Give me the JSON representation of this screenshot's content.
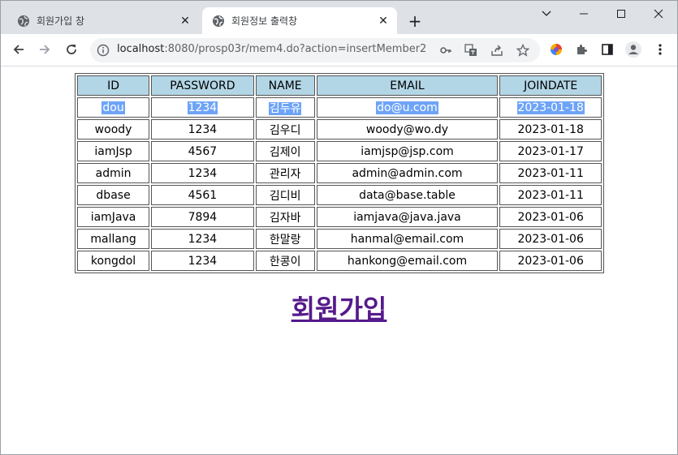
{
  "browser": {
    "tabs": [
      {
        "title": "회원가입 창",
        "active": false
      },
      {
        "title": "회원정보 출력창",
        "active": true
      }
    ],
    "url_host": "localhost",
    "url_path": ":8080/prosp03r/mem4.do?action=insertMember2"
  },
  "table": {
    "headers": [
      "ID",
      "PASSWORD",
      "NAME",
      "EMAIL",
      "JOINDATE"
    ],
    "rows": [
      [
        "dou",
        "1234",
        "김두유",
        "do@u.com",
        "2023-01-18"
      ],
      [
        "woody",
        "1234",
        "김우디",
        "woody@wo.dy",
        "2023-01-18"
      ],
      [
        "iamJsp",
        "4567",
        "김제이",
        "iamjsp@jsp.com",
        "2023-01-17"
      ],
      [
        "admin",
        "1234",
        "관리자",
        "admin@admin.com",
        "2023-01-11"
      ],
      [
        "dbase",
        "4561",
        "김디비",
        "data@base.table",
        "2023-01-11"
      ],
      [
        "iamJava",
        "7894",
        "김자바",
        "iamjava@java.java",
        "2023-01-06"
      ],
      [
        "mallang",
        "1234",
        "한말랑",
        "hanmal@email.com",
        "2023-01-06"
      ],
      [
        "kongdol",
        "1234",
        "한콩이",
        "hankong@email.com",
        "2023-01-06"
      ]
    ],
    "selected_row": 0
  },
  "page": {
    "signup_link": "회원가입"
  },
  "colors": {
    "header_bg": "#b3d6e6",
    "selection": "#6ea4f7",
    "link": "#551a8b"
  }
}
